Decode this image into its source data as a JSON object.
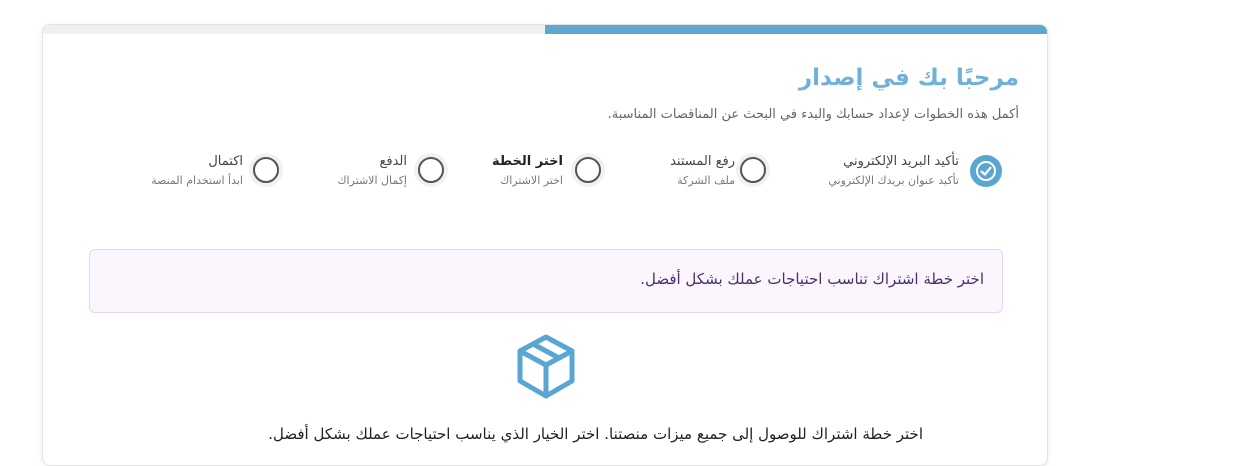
{
  "header": {
    "title": "مرحبًا بك في إصدار",
    "subtitle": "أكمل هذه الخطوات لإعداد حسابك والبدء في البحث عن المناقصات المناسبة."
  },
  "progress": {
    "fraction": 0.5,
    "color": "#5ea8cf"
  },
  "steps": [
    {
      "label": "تأكيد البريد الإلكتروني",
      "desc": "تأكيد عنوان بريدك الإلكتروني",
      "status": "done",
      "icon": "check-circle-icon"
    },
    {
      "label": "رفع المستند",
      "desc": "ملف الشركة",
      "status": "pending",
      "icon": "circle-icon"
    },
    {
      "label": "اختر الخطة",
      "desc": "اختر الاشتراك",
      "status": "active",
      "icon": "circle-icon"
    },
    {
      "label": "الدفع",
      "desc": "إكمال الاشتراك",
      "status": "pending",
      "icon": "circle-icon"
    },
    {
      "label": "اكتمال",
      "desc": "ابدأ استخدام المنصة",
      "status": "pending",
      "icon": "circle-icon"
    }
  ],
  "info": {
    "text": "اختر خطة اشتراك تناسب احتياجات عملك بشكل أفضل."
  },
  "main": {
    "icon": "package-box-icon",
    "text": "اختر خطة اشتراك للوصول إلى جميع ميزات منصتنا. اختر الخيار الذي يناسب احتياجات عملك بشكل أفضل."
  },
  "colors": {
    "accent": "#5ea8cf",
    "title": "#6fb1d8",
    "info_bg": "#fbf6fe",
    "info_border": "#e6d4f1"
  }
}
